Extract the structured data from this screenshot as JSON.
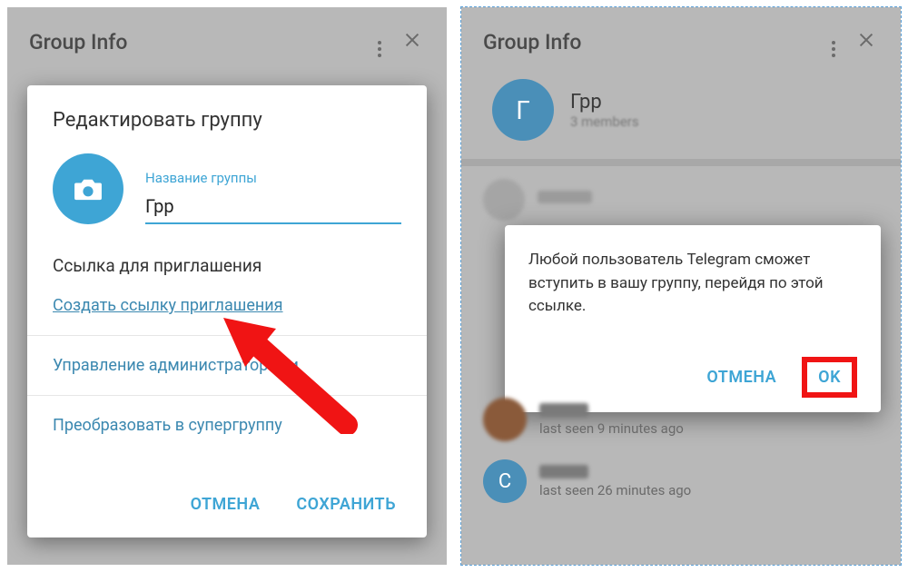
{
  "left": {
    "header_title": "Group Info",
    "dialog_title": "Редактировать группу",
    "name_label": "Название группы",
    "name_value": "Грр",
    "invite_section": "Ссылка для приглашения",
    "create_link": "Создать ссылку приглашения",
    "manage_admins": "Управление администраторами",
    "convert": "Преобразовать в супергруппу",
    "cancel": "ОТМЕНА",
    "save": "СОХРАНИТЬ"
  },
  "right": {
    "header_title": "Group Info",
    "group_name": "Грр",
    "group_sub": "3 members",
    "avatar_letter": "Г",
    "confirm_text": "Любой пользователь Telegram сможет вступить в вашу группу, перейдя по этой ссылке.",
    "cancel": "ОТМЕНА",
    "ok": "OK",
    "member1_sub": "last seen 9 minutes ago",
    "member2_letter": "С",
    "member2_sub": "last seen 26 minutes ago"
  }
}
